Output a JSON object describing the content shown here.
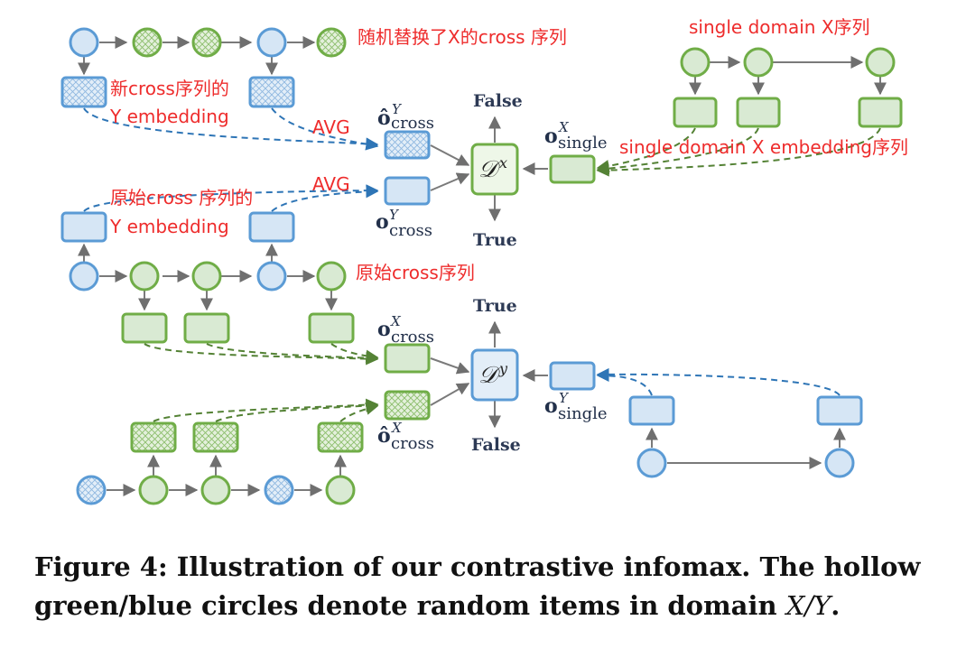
{
  "annotations": {
    "random_cross_seq": "随机替换了X的cross 序列",
    "new_cross_emb_line1": "新cross序列的",
    "new_cross_emb_line2": "Y embedding",
    "avg_top": "AVG",
    "avg_bottom": "AVG",
    "orig_cross_emb_line1": "原始cross 序列的",
    "orig_cross_emb_line2": "Y embedding",
    "orig_cross_seq": "原始cross序列",
    "single_domain_seq": "single domain X序列",
    "single_domain_emb": "single domain X embedding序列"
  },
  "top_discriminator": {
    "label": "𝒟",
    "superscript": "x",
    "output_up": "False",
    "output_down": "True"
  },
  "bottom_discriminator": {
    "label": "𝒟",
    "superscript": "y",
    "output_up": "True",
    "output_down": "False"
  },
  "vectors": {
    "o_hat_cross_Y": {
      "symbol": "ô",
      "sup": "Y",
      "sub": "cross"
    },
    "o_cross_Y": {
      "symbol": "o",
      "sup": "Y",
      "sub": "cross"
    },
    "o_single_X": {
      "symbol": "o",
      "sup": "X",
      "sub": "single"
    },
    "o_cross_X": {
      "symbol": "o",
      "sup": "X",
      "sub": "cross"
    },
    "o_hat_cross_X": {
      "symbol": "ô",
      "sup": "X",
      "sub": "cross"
    },
    "o_single_Y": {
      "symbol": "o",
      "sup": "Y",
      "sub": "single"
    }
  },
  "colors": {
    "blue_stroke": "#5b9bd5",
    "blue_fill": "#d6e6f5",
    "green_stroke": "#70ad47",
    "green_fill": "#d9ead3",
    "annotation_red": "#ee2c2c",
    "link_blue": "#2e75b6",
    "link_green": "#548235"
  },
  "caption": {
    "bold_text": "Figure 4: Illustration of our contrastive infomax. The hollow green/blue circles denote random items in domain ",
    "math": "X/Y",
    "end": "."
  }
}
